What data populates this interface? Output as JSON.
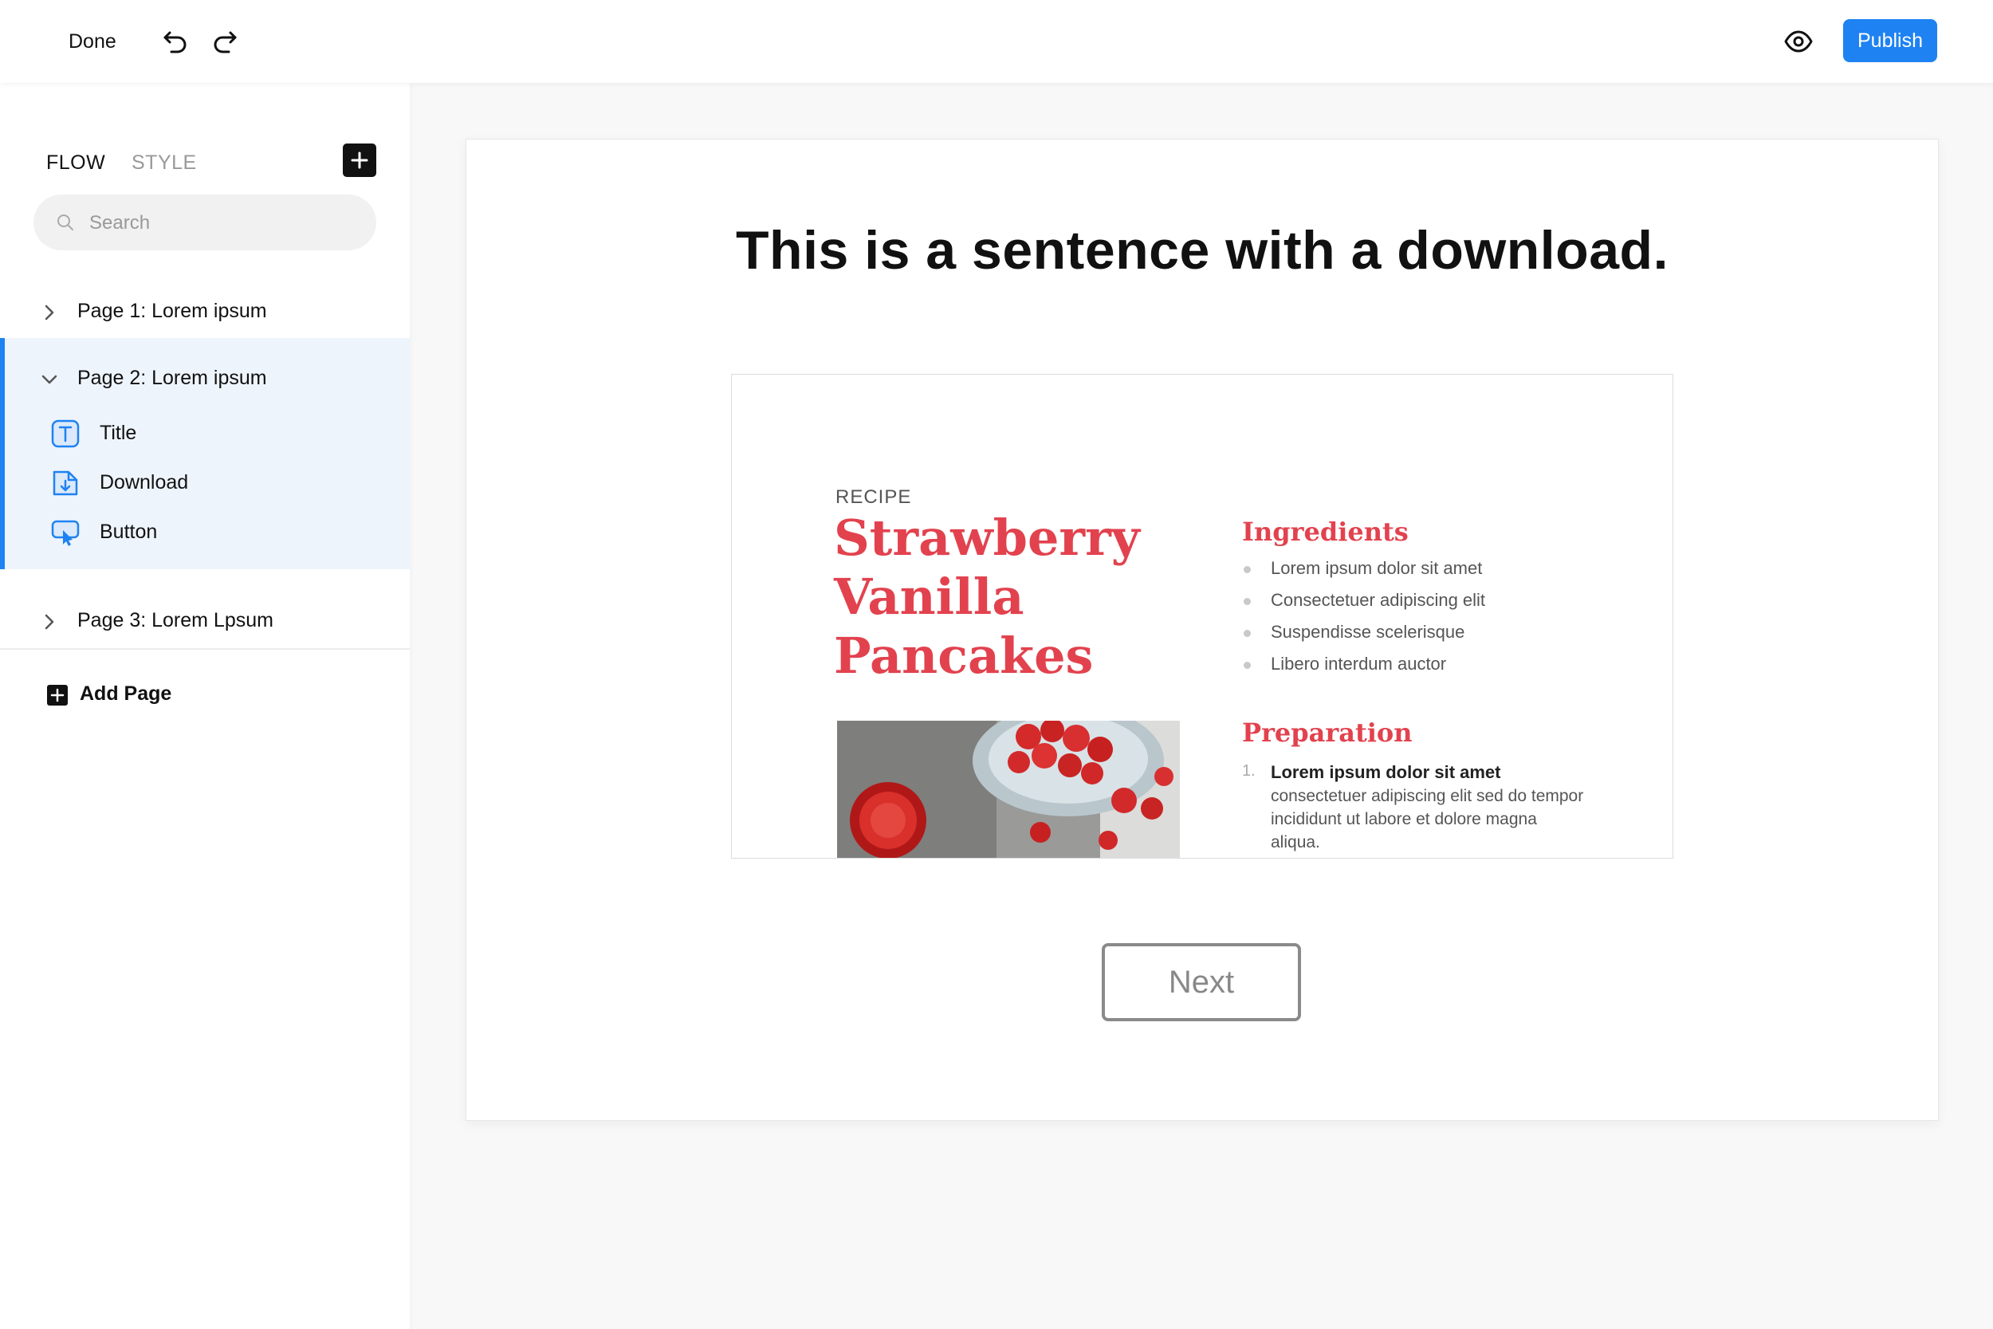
{
  "toolbar": {
    "done_label": "Done",
    "undo_icon": "undo-icon",
    "redo_icon": "redo-icon",
    "preview_icon": "eye-icon",
    "publish_label": "Publish",
    "accent_color": "#1e82f2"
  },
  "sidebar": {
    "tabs": [
      {
        "label": "FLOW",
        "active": true
      },
      {
        "label": "STYLE",
        "active": false
      }
    ],
    "add_icon": "plus-icon",
    "search": {
      "placeholder": "Search",
      "value": ""
    },
    "pages": [
      {
        "label": "Page 1: Lorem ipsum",
        "expanded": false
      },
      {
        "label": "Page 2: Lorem ipsum",
        "expanded": true,
        "children": [
          {
            "label": "Title",
            "icon": "title-text-icon"
          },
          {
            "label": "Download",
            "icon": "download-file-icon"
          },
          {
            "label": "Button",
            "icon": "button-cursor-icon"
          }
        ]
      },
      {
        "label": "Page 3: Lorem Lpsum",
        "expanded": false
      }
    ],
    "add_page_label": "Add Page"
  },
  "canvas": {
    "title": "This is a sentence with a download.",
    "download_preview": {
      "recipe_label": "RECIPE",
      "recipe_title": [
        "Strawberry",
        "Vanilla",
        "Pancakes"
      ],
      "ingredients_heading": "Ingredients",
      "ingredients": [
        "Lorem ipsum dolor sit amet",
        "Consectetuer adipiscing elit",
        "Suspendisse scelerisque",
        "Libero interdum auctor"
      ],
      "preparation_heading": "Preparation",
      "preparation_step_number": "1.",
      "preparation_step_bold": "Lorem ipsum dolor sit amet",
      "preparation_step_text": "consectetuer adipiscing elit sed do tempor incididunt ut labore et dolore magna aliqua.",
      "accent_color": "#e2424e"
    },
    "next_label": "Next"
  }
}
